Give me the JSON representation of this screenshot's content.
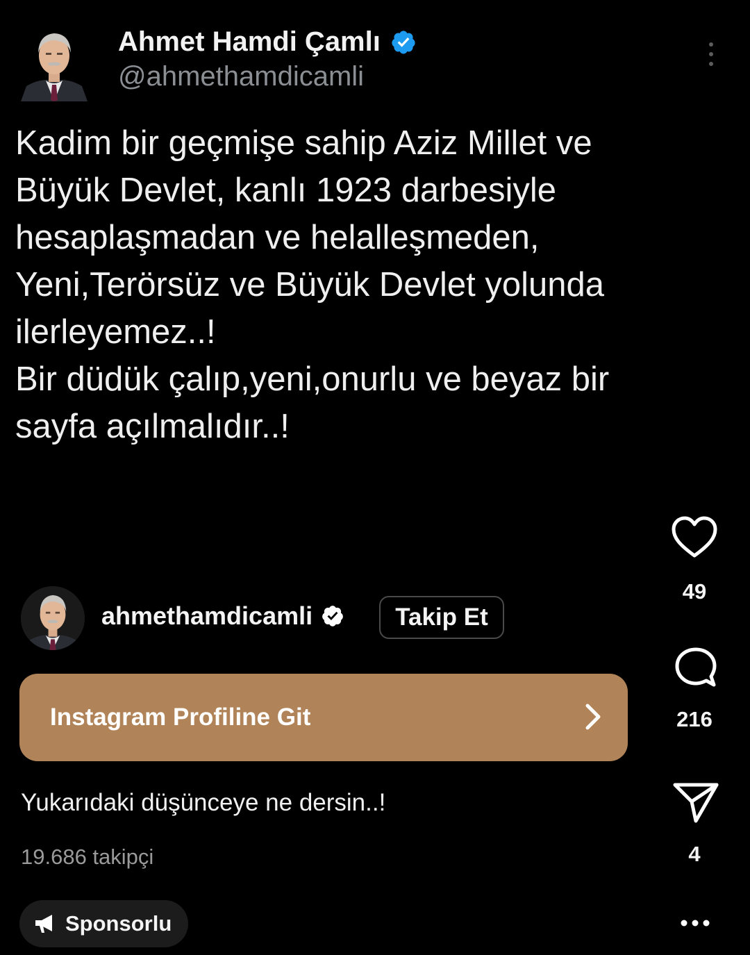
{
  "tweet": {
    "author_name": "Ahmet Hamdi Çamlı",
    "handle": "@ahmethamdicamli",
    "text_lines": [
      "Kadim bir geçmişe sahip Aziz Millet  ve",
      "Büyük Devlet, kanlı 1923 darbesiyle",
      "hesaplaşmadan ve helalleşmeden,",
      "Yeni,Terörsüz ve Büyük Devlet yolunda",
      "ilerleyemez..!",
      "Bir düdük çalıp,yeni,onurlu ve beyaz bir",
      "sayfa açılmalıdır..!"
    ],
    "verified_icon": "verified-badge-icon",
    "more_icon": "more-vertical-icon"
  },
  "actions": {
    "likes": "49",
    "comments": "216",
    "shares": "4",
    "like_icon": "heart-icon",
    "comment_icon": "comment-bubble-icon",
    "share_icon": "paper-plane-icon"
  },
  "instagram": {
    "username": "ahmethamdicamli",
    "follow_label": "Takip Et",
    "cta_label": "Instagram Profiline Git",
    "caption": "Yukarıdaki düşünceye ne dersin..!",
    "followers": "19.686 takipçi",
    "sponsored_label": "Sponsorlu",
    "more_icon": "more-horizontal-icon"
  },
  "colors": {
    "background": "#000000",
    "cta_background": "#b08458",
    "verified_blue": "#1d9bf0",
    "handle_gray": "#8b8f94"
  }
}
